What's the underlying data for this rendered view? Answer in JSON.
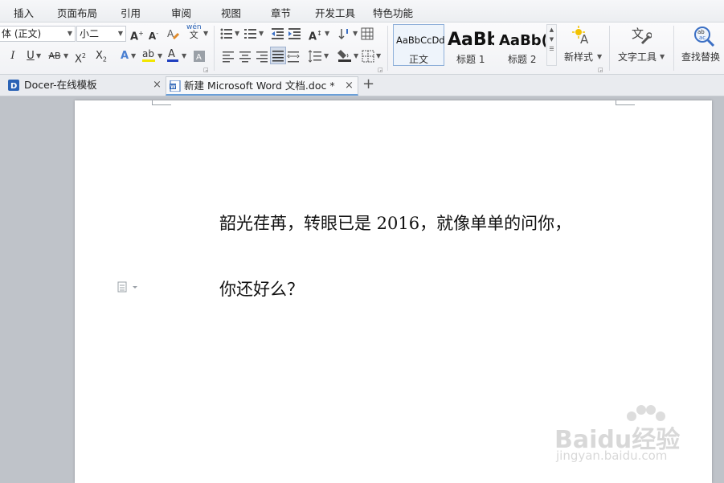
{
  "menu": {
    "items": [
      "插入",
      "页面布局",
      "引用",
      "审阅",
      "视图",
      "章节",
      "开发工具",
      "特色功能"
    ]
  },
  "ribbon": {
    "font_name": "体 (正文)",
    "font_size": "小二",
    "styles": [
      {
        "sample": "AaBbCcDd",
        "label": "正文"
      },
      {
        "sample": "AaBb",
        "label": "标题 1"
      },
      {
        "sample": "AaBb(",
        "label": "标题 2"
      }
    ],
    "new_style_label": "新样式",
    "text_tools_label": "文字工具",
    "find_replace_label": "查找替换",
    "pinyin_glyph_top": "wén",
    "pinyin_glyph_bottom": "文"
  },
  "tabs": [
    {
      "label": "Docer-在线模板",
      "icon": "docer-icon",
      "active": false
    },
    {
      "label": "新建 Microsoft Word 文档.doc *",
      "icon": "word-doc-icon",
      "active": true
    }
  ],
  "document": {
    "lines": [
      "韶光荏苒，转眼已是 2016，就像单单的问你，",
      "你还好么？"
    ]
  },
  "watermark": {
    "brand": "Baidu经验",
    "url": "jingyan.baidu.com"
  },
  "colors": {
    "accent": "#6a9fd8",
    "font_color_bar": "#1f3fbf",
    "highlight_bar": "#f2e600",
    "workspace": "#bfc3c9"
  }
}
